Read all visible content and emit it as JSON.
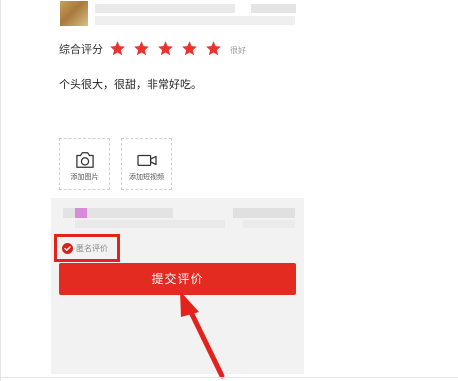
{
  "rating": {
    "label": "综合评分",
    "stars": 5,
    "star_color": "#e8342c",
    "status_text": "很好"
  },
  "review": {
    "text": "个头很大，很甜，非常好吃。"
  },
  "upload": {
    "photo_label": "添加图片",
    "video_label": "添加短视频",
    "photo_icon": "camera-icon",
    "video_icon": "video-camera-icon"
  },
  "anonymous": {
    "label": "匿名评价",
    "checked": true
  },
  "submit": {
    "label": "提交评价",
    "color": "#e32b22"
  },
  "annotation": {
    "highlight_color": "#e4221c"
  }
}
